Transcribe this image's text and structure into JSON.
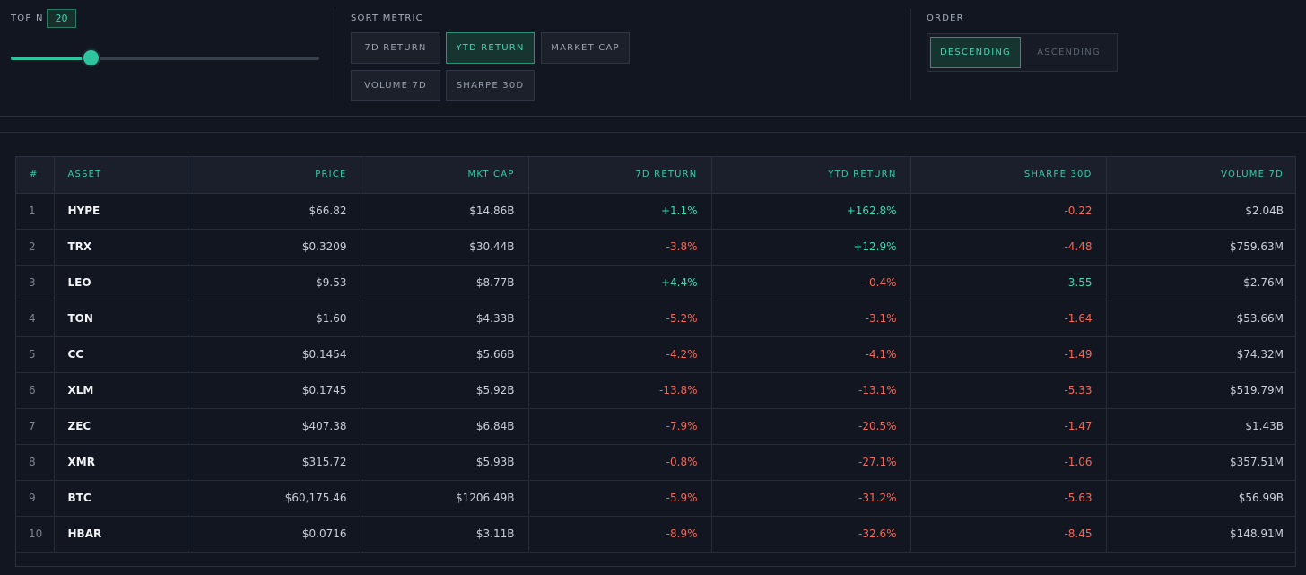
{
  "top_n": {
    "label": "TOP N",
    "value": "20",
    "fraction": 0.26
  },
  "sort_metric": {
    "label": "SORT METRIC",
    "options": [
      "7D RETURN",
      "YTD RETURN",
      "MARKET CAP",
      "VOLUME 7D",
      "SHARPE 30D"
    ],
    "selected": "YTD RETURN"
  },
  "order": {
    "label": "ORDER",
    "options": [
      "DESCENDING",
      "ASCENDING"
    ],
    "selected": "DESCENDING"
  },
  "table": {
    "headers": [
      "#",
      "ASSET",
      "PRICE",
      "MKT CAP",
      "7D RETURN",
      "YTD RETURN",
      "SHARPE 30D",
      "VOLUME 7D"
    ],
    "rows": [
      {
        "rank": "1",
        "asset": "HYPE",
        "price": "$66.82",
        "mkt_cap": "$14.86B",
        "ret_7d": "+1.1%",
        "ret_ytd": "+162.8%",
        "sharpe": "-0.22",
        "volume": "$2.04B"
      },
      {
        "rank": "2",
        "asset": "TRX",
        "price": "$0.3209",
        "mkt_cap": "$30.44B",
        "ret_7d": "-3.8%",
        "ret_ytd": "+12.9%",
        "sharpe": "-4.48",
        "volume": "$759.63M"
      },
      {
        "rank": "3",
        "asset": "LEO",
        "price": "$9.53",
        "mkt_cap": "$8.77B",
        "ret_7d": "+4.4%",
        "ret_ytd": "-0.4%",
        "sharpe": "3.55",
        "volume": "$2.76M"
      },
      {
        "rank": "4",
        "asset": "TON",
        "price": "$1.60",
        "mkt_cap": "$4.33B",
        "ret_7d": "-5.2%",
        "ret_ytd": "-3.1%",
        "sharpe": "-1.64",
        "volume": "$53.66M"
      },
      {
        "rank": "5",
        "asset": "CC",
        "price": "$0.1454",
        "mkt_cap": "$5.66B",
        "ret_7d": "-4.2%",
        "ret_ytd": "-4.1%",
        "sharpe": "-1.49",
        "volume": "$74.32M"
      },
      {
        "rank": "6",
        "asset": "XLM",
        "price": "$0.1745",
        "mkt_cap": "$5.92B",
        "ret_7d": "-13.8%",
        "ret_ytd": "-13.1%",
        "sharpe": "-5.33",
        "volume": "$519.79M"
      },
      {
        "rank": "7",
        "asset": "ZEC",
        "price": "$407.38",
        "mkt_cap": "$6.84B",
        "ret_7d": "-7.9%",
        "ret_ytd": "-20.5%",
        "sharpe": "-1.47",
        "volume": "$1.43B"
      },
      {
        "rank": "8",
        "asset": "XMR",
        "price": "$315.72",
        "mkt_cap": "$5.93B",
        "ret_7d": "-0.8%",
        "ret_ytd": "-27.1%",
        "sharpe": "-1.06",
        "volume": "$357.51M"
      },
      {
        "rank": "9",
        "asset": "BTC",
        "price": "$60,175.46",
        "mkt_cap": "$1206.49B",
        "ret_7d": "-5.9%",
        "ret_ytd": "-31.2%",
        "sharpe": "-5.63",
        "volume": "$56.99B"
      },
      {
        "rank": "10",
        "asset": "HBAR",
        "price": "$0.0716",
        "mkt_cap": "$3.11B",
        "ret_7d": "-8.9%",
        "ret_ytd": "-32.6%",
        "sharpe": "-8.45",
        "volume": "$148.91M"
      }
    ]
  },
  "colors": {
    "accent": "#2ec4a0",
    "positive": "#3fd8b2",
    "negative": "#f0695a",
    "background": "#121621"
  }
}
